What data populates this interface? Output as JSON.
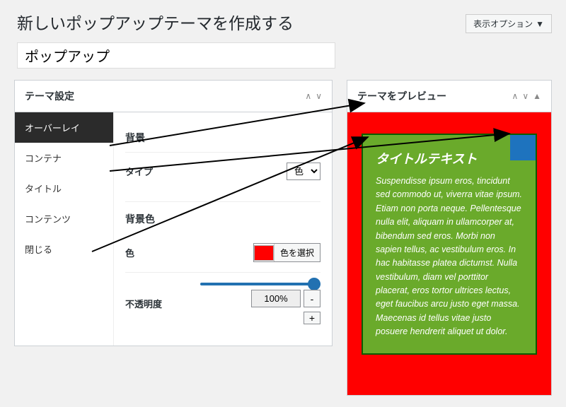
{
  "screen_options": "表示オプション",
  "page_title": "新しいポップアップテーマを作成する",
  "title_input_value": "ポップアップ",
  "theme_settings_title": "テーマ設定",
  "preview_title": "テーマをプレビュー",
  "tabs": {
    "overlay": "オーバーレイ",
    "container": "コンテナ",
    "title": "タイトル",
    "contents": "コンテンツ",
    "close": "閉じる"
  },
  "section": {
    "background": "背景",
    "type_label": "タイプ",
    "type_value": "色",
    "bgcolor": "背景色",
    "color_label": "色",
    "color_swatch": "#ff0000",
    "select_color_btn": "色を選択",
    "opacity_label": "不透明度",
    "opacity_value": "100%"
  },
  "preview": {
    "popup_title": "タイトルテキスト",
    "popup_text": "Suspendisse ipsum eros, tincidunt sed commodo ut, viverra vitae ipsum. Etiam non porta neque. Pellentesque nulla elit, aliquam in ullamcorper at, bibendum sed eros. Morbi non sapien tellus, ac vestibulum eros. In hac habitasse platea dictumst. Nulla vestibulum, diam vel porttitor placerat, eros tortor ultrices lectus, eget faucibus arcu justo eget massa. Maecenas id tellus vitae justo posuere hendrerit aliquet ut dolor."
  }
}
